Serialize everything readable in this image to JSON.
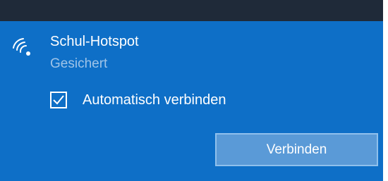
{
  "network": {
    "name": "Schul-Hotspot",
    "status": "Gesichert",
    "icon": "wifi-secured-icon"
  },
  "options": {
    "auto_connect_label": "Automatisch verbinden",
    "auto_connect_checked": true
  },
  "actions": {
    "connect_label": "Verbinden"
  },
  "colors": {
    "card_background": "#0e6fc7",
    "top_strip": "#1f2a39",
    "status_text": "#9fc4e8",
    "button_background": "#5a9ad7",
    "button_border": "#8fc0ec"
  }
}
